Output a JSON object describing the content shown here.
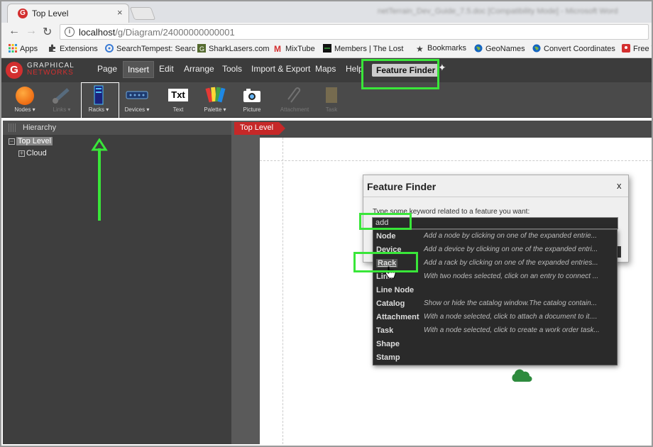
{
  "browser": {
    "tab_title": "Top Level",
    "tab_close": "×",
    "window_title": "netTerrain_Dev_Guide_7.5.doc [Compatibility Mode] - Microsoft Word",
    "url_host": "localhost",
    "url_path": "/g/Diagram/24000000000001",
    "bookmarks": [
      {
        "label": "Apps",
        "icon": "apps-grid-icon",
        "color": "#e74c3c"
      },
      {
        "label": "Extensions",
        "icon": "puzzle-icon",
        "color": "#444444"
      },
      {
        "label": "SearchTempest: Searc",
        "icon": "search-tempest-icon",
        "color": "#3a7bd5"
      },
      {
        "label": "SharkLasers.com",
        "icon": "shark-icon",
        "color": "#556b2f"
      },
      {
        "label": "MixTube",
        "icon": "mixtube-icon",
        "color": "#d32f2f"
      },
      {
        "label": "Members | The Lost",
        "icon": "members-icon",
        "color": "#2e7d32"
      },
      {
        "label": "Bookmarks",
        "icon": "star-icon",
        "color": "#444444"
      },
      {
        "label": "GeoNames",
        "icon": "globe-icon",
        "color": "#1565c0"
      },
      {
        "label": "Convert Coordinates",
        "icon": "globe-icon",
        "color": "#1565c0"
      },
      {
        "label": "Free V",
        "icon": "map-pin-icon",
        "color": "#d32f2f"
      }
    ]
  },
  "app": {
    "logo_line1": "GRAPHICAL",
    "logo_line2": "NETWORKS",
    "menu": [
      "Page",
      "Insert",
      "Edit",
      "Arrange",
      "Tools",
      "Import & Export",
      "Maps",
      "Help"
    ],
    "active_menu": "Insert",
    "feature_finder_button": "Feature Finder",
    "toolbar": [
      {
        "label": "Nodes ▾",
        "icon": "orange-circle-icon",
        "enabled": true
      },
      {
        "label": "Links ▾",
        "icon": "link-icon",
        "enabled": false
      },
      {
        "label": "Racks ▾",
        "icon": "rack-icon",
        "enabled": true
      },
      {
        "label": "Devices ▾",
        "icon": "device-icon",
        "enabled": true
      },
      {
        "label": "Text",
        "icon": "text-icon",
        "enabled": true
      },
      {
        "label": "Palette ▾",
        "icon": "palette-icon",
        "enabled": true
      },
      {
        "label": "Picture",
        "icon": "camera-icon",
        "enabled": true
      },
      {
        "label": "Attachment",
        "icon": "paperclip-icon",
        "enabled": false
      },
      {
        "label": "Task",
        "icon": "task-icon",
        "enabled": false
      }
    ],
    "hierarchy_title": "Hierarchy",
    "tree": {
      "root": "Top Level",
      "child": "Cloud"
    },
    "breadcrumb": "Top Level"
  },
  "dialog": {
    "title": "Feature Finder",
    "close": "x",
    "prompt": "Type some keyword related to a feature you want:",
    "input_value": "add",
    "results": [
      {
        "name": "Node",
        "desc": "Add a node by clicking on one of the expanded entrie..."
      },
      {
        "name": "Device",
        "desc": "Add a device by clicking on one of the expanded entri..."
      },
      {
        "name": "Rack",
        "desc": "Add a rack by clicking on one of the expanded entries..."
      },
      {
        "name": "Link",
        "desc": "With two nodes selected, click on an entry to connect ..."
      },
      {
        "name": "Line Node",
        "desc": ""
      },
      {
        "name": "Catalog",
        "desc": "Show or hide the catalog window.The catalog contain..."
      },
      {
        "name": "Attachment",
        "desc": "With a node selected, click to attach a document to it...."
      },
      {
        "name": "Task",
        "desc": "With a node selected, click to create a work order task..."
      },
      {
        "name": "Shape",
        "desc": ""
      },
      {
        "name": "Stamp",
        "desc": ""
      }
    ]
  },
  "colors": {
    "highlight_green": "#39e639",
    "brand_red": "#d32f2f",
    "cloud_green": "#2e8b3e"
  }
}
